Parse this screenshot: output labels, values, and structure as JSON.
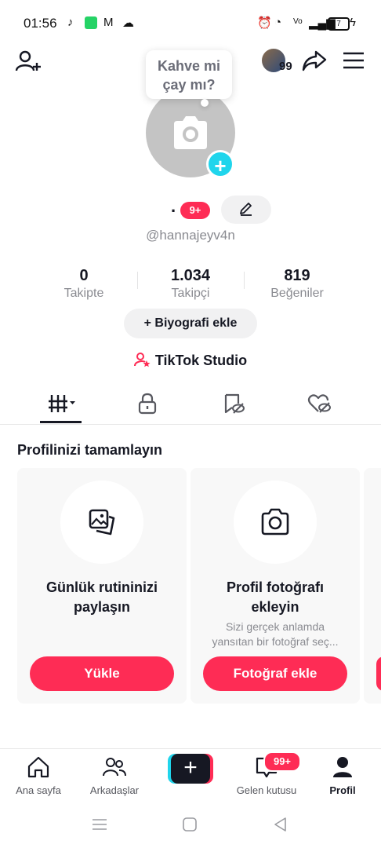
{
  "status_bar": {
    "time": "01:56",
    "battery": "7"
  },
  "profile": {
    "bubble_line1": "Kahve mi",
    "bubble_line2": "çay mı?",
    "display_name": ".",
    "notif_badge": "9+",
    "username": "@hannajeyv4n",
    "header_badge": "99"
  },
  "stats": [
    {
      "num": "0",
      "label": "Takipte"
    },
    {
      "num": "1.034",
      "label": "Takipçi"
    },
    {
      "num": "819",
      "label": "Beğeniler"
    }
  ],
  "bio_button": "+ Biyografi ekle",
  "studio_label": "TikTok Studio",
  "section_title": "Profilinizi tamamlayın",
  "cards": [
    {
      "title1": "Günlük rutininizi",
      "title2": "paylaşın",
      "desc1": "",
      "desc2": "",
      "button": "Yükle"
    },
    {
      "title1": "Profil fotoğrafı",
      "title2": "ekleyin",
      "desc1": "Sizi gerçek anlamda",
      "desc2": "yansıtan bir fotoğraf seç...",
      "button": "Fotoğraf ekle"
    }
  ],
  "bottom_nav": {
    "home": "Ana sayfa",
    "friends": "Arkadaşlar",
    "inbox": "Gelen kutusu",
    "inbox_badge": "99+",
    "profile": "Profil"
  },
  "colors": {
    "accent": "#fe2c55",
    "cyan": "#20d5ec"
  }
}
